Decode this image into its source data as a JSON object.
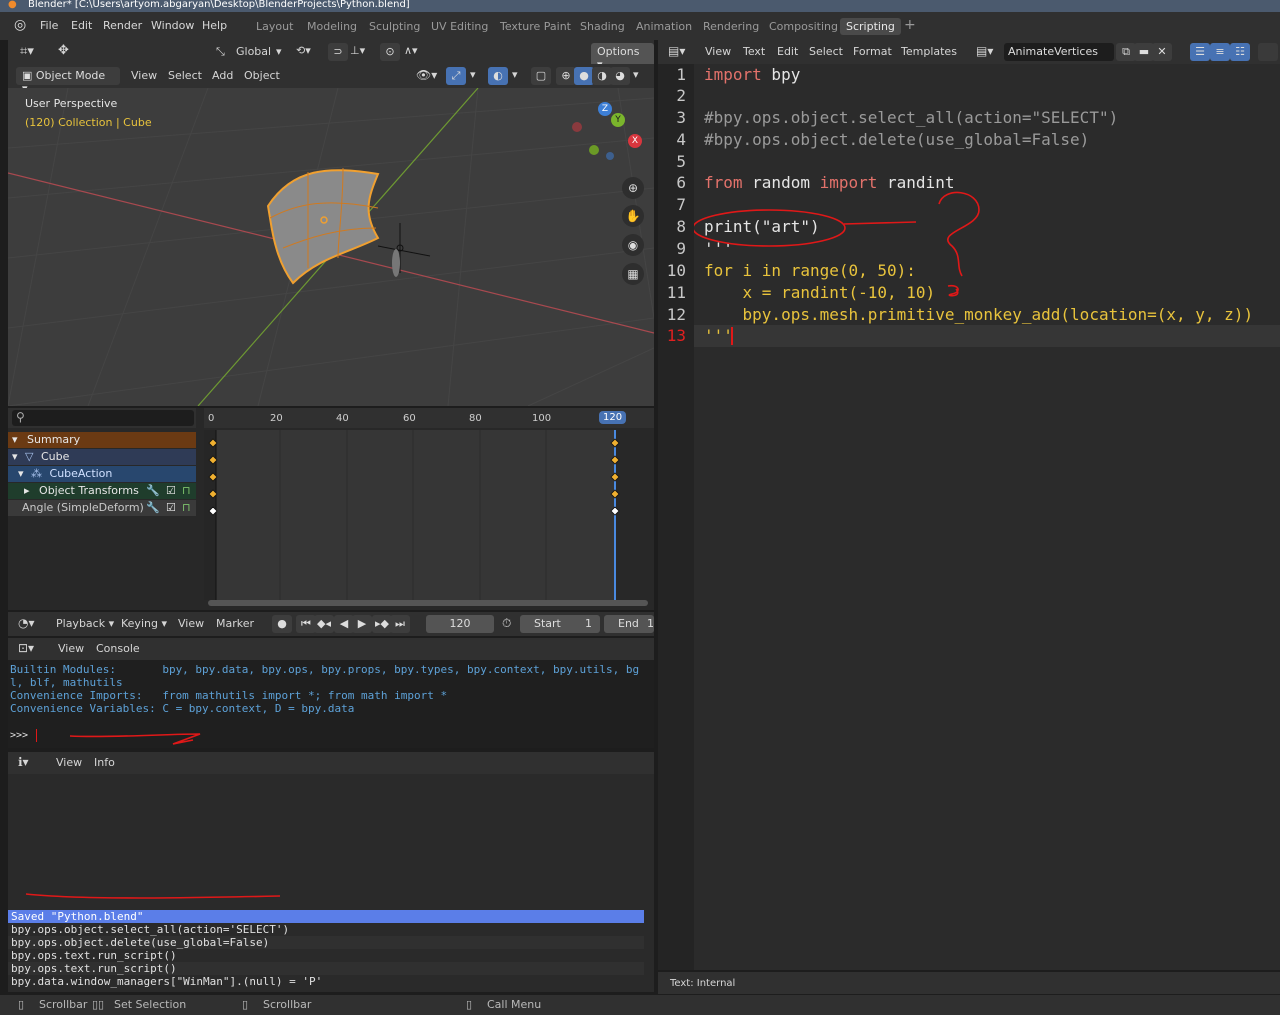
{
  "window": {
    "title": "Blender* [C:\\Users\\artyom.abgaryan\\Desktop\\BlenderProjects\\Python.blend]"
  },
  "menu": {
    "file": "File",
    "edit": "Edit",
    "render": "Render",
    "window": "Window",
    "help": "Help"
  },
  "workspaces": [
    {
      "label": "Layout"
    },
    {
      "label": "Modeling"
    },
    {
      "label": "Sculpting"
    },
    {
      "label": "UV Editing"
    },
    {
      "label": "Texture Paint"
    },
    {
      "label": "Shading"
    },
    {
      "label": "Animation"
    },
    {
      "label": "Rendering"
    },
    {
      "label": "Compositing"
    },
    {
      "label": "Scripting"
    }
  ],
  "add_workspace": "+",
  "viewport": {
    "orientation": "Global",
    "options": "Options",
    "mode": "Object Mode",
    "menus": {
      "view": "View",
      "select": "Select",
      "add": "Add",
      "object": "Object"
    },
    "overlay_title": "User Perspective",
    "overlay_subtitle": "(120) Collection | Cube",
    "gizmo": {
      "z": "Z",
      "y": "Y",
      "x": "X"
    }
  },
  "dopesheet": {
    "ticks": [
      "0",
      "20",
      "40",
      "60",
      "80",
      "100",
      "120"
    ],
    "current_frame": "120",
    "channels": {
      "summary": "Summary",
      "cube": "Cube",
      "cube_action": "CubeAction",
      "object_transforms": "Object Transforms",
      "angle": "Angle (SimpleDeform)"
    }
  },
  "timeline": {
    "playback": "Playback",
    "keying": "Keying",
    "view": "View",
    "marker": "Marker",
    "frame": "120",
    "start_label": "Start",
    "start_value": "1",
    "end_label": "End",
    "end_value": "1"
  },
  "console": {
    "view": "View",
    "console": "Console",
    "lines": [
      "Builtin Modules:       bpy, bpy.data, bpy.ops, bpy.props, bpy.types, bpy.context, bpy.utils, bg",
      "l, blf, mathutils",
      "Convenience Imports:   from mathutils import *; from math import *",
      "Convenience Variables: C = bpy.context, D = bpy.data"
    ],
    "prompt": ">>>"
  },
  "info": {
    "view": "View",
    "info": "Info",
    "lines": [
      "Saved \"Python.blend\"",
      "bpy.ops.object.select_all(action='SELECT')",
      "bpy.ops.object.delete(use_global=False)",
      "bpy.ops.text.run_script()",
      "bpy.ops.text.run_script()",
      "bpy.data.window_managers[\"WinMan\"].(null) = 'P'"
    ]
  },
  "text_editor": {
    "menus": {
      "view": "View",
      "text": "Text",
      "edit": "Edit",
      "select": "Select",
      "format": "Format",
      "templates": "Templates"
    },
    "filename": "AnimateVertices",
    "footer": "Text: Internal",
    "line_numbers": [
      "1",
      "2",
      "3",
      "4",
      "5",
      "6",
      "7",
      "8",
      "9",
      "10",
      "11",
      "12",
      "13"
    ],
    "lines": {
      "l1_kw": "import",
      "l1_rest": " bpy",
      "l3": "#bpy.ops.object.select_all(action=\"SELECT\")",
      "l4": "#bpy.ops.object.delete(use_global=False)",
      "l6_kw1": "from",
      "l6_mid": " random ",
      "l6_kw2": "import",
      "l6_rest": " randint",
      "l8": "print(\"art\")",
      "l9": "'''",
      "l10": "for i in range(0, 50):",
      "l11": "    x = randint(-10, 10)",
      "l12": "    bpy.ops.mesh.primitive_monkey_add(location=(x, y, z))",
      "l13": "'''"
    }
  },
  "statusbar": {
    "scrollbar1": "Scrollbar",
    "set_selection": "Set Selection",
    "scrollbar2": "Scrollbar",
    "call_menu": "Call Menu"
  },
  "colors": {
    "accent_blue": "#4772b3",
    "keyword": "#e3726b",
    "console_blue": "#5da1d7",
    "annotation_red": "#e01818",
    "selection_orange": "#f0a030"
  }
}
